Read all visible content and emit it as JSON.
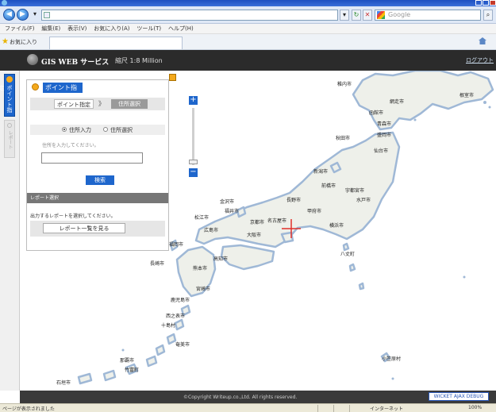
{
  "browser": {
    "address": "",
    "search_placeholder": "Google",
    "menus": [
      "ファイル(F)",
      "編集(E)",
      "表示(V)",
      "お気に入り(A)",
      "ツール(T)",
      "ヘルプ(H)"
    ],
    "favorites_label": "お気に入り"
  },
  "header": {
    "title": "GIS WEB サービス",
    "scale": "縮尺 1:8 Million",
    "link": "ログアウト"
  },
  "sidebar": {
    "tabs": [
      {
        "label": "ポイント指定",
        "active": true
      },
      {
        "label": "レポート",
        "active": false
      }
    ]
  },
  "panel": {
    "title": "ポイント指定",
    "steps": {
      "step1": "ポイント指定",
      "arrow": "》",
      "step2": "住所選択"
    },
    "radio": {
      "option1": "住所入力",
      "option2": "住所選択",
      "selected": "option1"
    },
    "instruction": "住所を入力してください。",
    "input_value": "",
    "search_button": "検索",
    "report_header": "レポート選択",
    "report_instruction": "出力するレポートを選択してください。",
    "report_button": "レポート一覧を見る"
  },
  "map": {
    "marker_color": "#e0302a",
    "land_color": "#eef0ea",
    "coast_color": "#9fb8d6",
    "labels": [
      "稚内市",
      "網走市",
      "根室市",
      "函館市",
      "青森市",
      "盛岡市",
      "秋田市",
      "仙台市",
      "新潟市",
      "金沢市",
      "長野市",
      "前橋市",
      "宇都宮市",
      "水戸市",
      "甲府市",
      "横浜市",
      "名古屋市",
      "福井市",
      "京都市",
      "大阪市",
      "広島市",
      "松江市",
      "高知市",
      "福岡市",
      "長崎市",
      "熊本市",
      "宮崎市",
      "鹿児島市",
      "奄美市",
      "那覇市",
      "石垣市",
      "小笠原村",
      "八丈町",
      "西之表市",
      "十島村",
      "竹富町"
    ]
  },
  "footer": {
    "copyright": "©Copyright Writeup.co.,Ltd. All rights reserved.",
    "debug": "WICKET AJAX DEBUG",
    "status": "ページが表示されました",
    "zone": "インターネット",
    "zoom": "100%"
  }
}
